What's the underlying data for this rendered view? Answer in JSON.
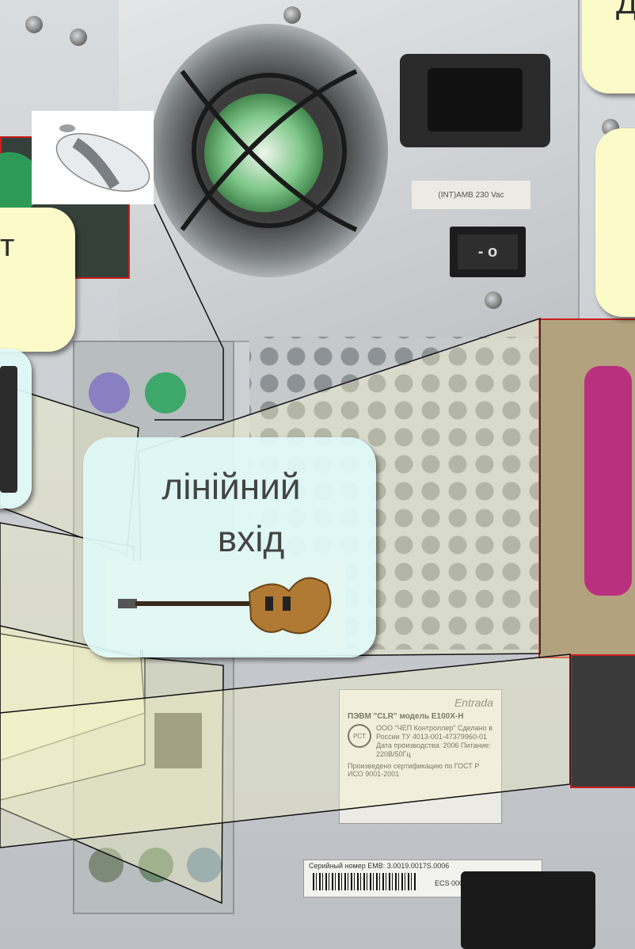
{
  "callouts": {
    "port_label_partial": "т",
    "top_right_partial": "Д",
    "line_in": {
      "line1": "лінійний",
      "line2": "вхід"
    }
  },
  "case_labels": {
    "switch_symbols": "- o",
    "psu_plate": "(INT)AMB 230 Vac",
    "sticker": {
      "brand": "Entrada",
      "model_line": "ПЭВМ \"CLR\" модель E100X-H",
      "body": "ООО \"ЧЕП Контроллер\" Сделано в России ТУ 4013-001-47379960-01 Дата производства: 2006 Питание: 220В/50Гц",
      "standard": "Произведено сертификацию по ГОСТ Р ИСО 9001-2001",
      "seal": "РСТ"
    },
    "serial_label": "Серийный номер ЕМВ: 3.0019.0017S.0006",
    "serial_code": "ECS 000000-013"
  },
  "colors": {
    "callout_yellow": "#fbfac8",
    "callout_cyan": "#e0faf8",
    "highlight_red": "#cc1e1e",
    "ps2_green": "#3ea86b",
    "ps2_purple": "#8a7fc0",
    "parallel_magenta": "#b9307f"
  }
}
